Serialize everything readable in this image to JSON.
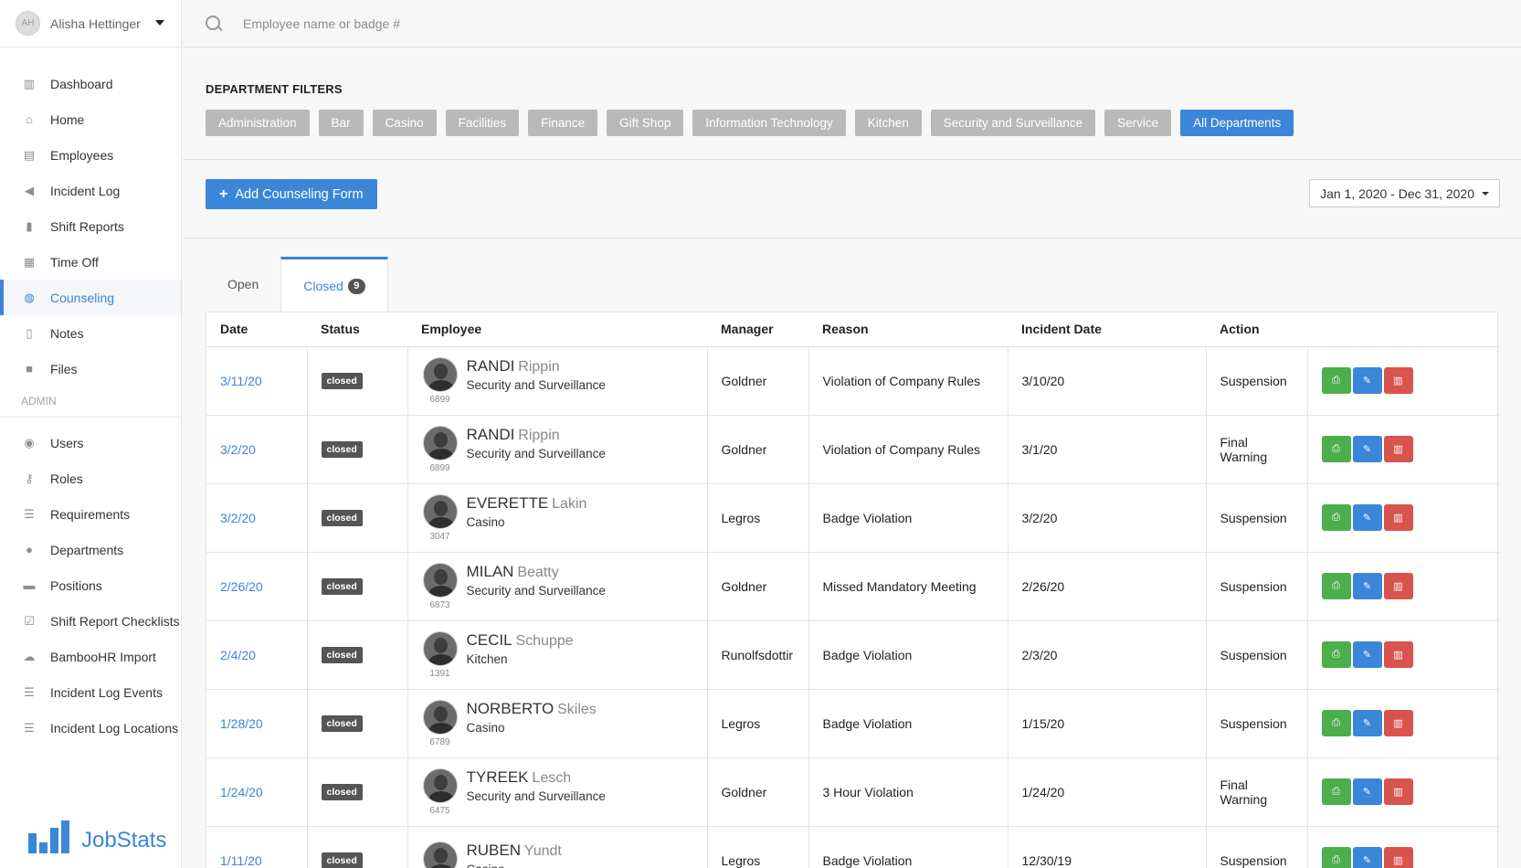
{
  "user": {
    "initials": "AH",
    "name": "Alisha Hettinger"
  },
  "nav": [
    {
      "label": "Dashboard",
      "icon": "bar-chart-icon",
      "glyph": "▥"
    },
    {
      "label": "Home",
      "icon": "home-icon",
      "glyph": "⌂"
    },
    {
      "label": "Employees",
      "icon": "id-card-icon",
      "glyph": "▤"
    },
    {
      "label": "Incident Log",
      "icon": "megaphone-icon",
      "glyph": "◀"
    },
    {
      "label": "Shift Reports",
      "icon": "file-icon",
      "glyph": "▮"
    },
    {
      "label": "Time Off",
      "icon": "calendar-icon",
      "glyph": "▦"
    },
    {
      "label": "Counseling",
      "icon": "comments-icon",
      "glyph": "◍"
    },
    {
      "label": "Notes",
      "icon": "file-text-icon",
      "glyph": "▯"
    },
    {
      "label": "Files",
      "icon": "folder-icon",
      "glyph": "■"
    }
  ],
  "admin_label": "ADMIN",
  "admin_nav": [
    {
      "label": "Users",
      "icon": "user-circle-icon",
      "glyph": "◉"
    },
    {
      "label": "Roles",
      "icon": "key-icon",
      "glyph": "⚷"
    },
    {
      "label": "Requirements",
      "icon": "list-icon",
      "glyph": "☰"
    },
    {
      "label": "Departments",
      "icon": "users-icon",
      "glyph": "●"
    },
    {
      "label": "Positions",
      "icon": "briefcase-icon",
      "glyph": "▬"
    },
    {
      "label": "Shift Report Checklists",
      "icon": "check-square-icon",
      "glyph": "☑"
    },
    {
      "label": "BambooHR Import",
      "icon": "cloud-download-icon",
      "glyph": "☁"
    },
    {
      "label": "Incident Log Events",
      "icon": "list-icon",
      "glyph": "☰"
    },
    {
      "label": "Incident Log Locations",
      "icon": "list-icon",
      "glyph": "☰"
    }
  ],
  "brand": "JobStats",
  "search": {
    "placeholder": "Employee name or badge #"
  },
  "filters": {
    "title": "DEPARTMENT FILTERS",
    "items": [
      "Administration",
      "Bar",
      "Casino",
      "Facilities",
      "Finance",
      "Gift Shop",
      "Information Technology",
      "Kitchen",
      "Security and Surveillance",
      "Service",
      "All Departments"
    ],
    "active": "All Departments"
  },
  "toolbar": {
    "add_label": "Add Counseling Form",
    "date_range": "Jan 1, 2020 - Dec 31, 2020"
  },
  "tabs": {
    "open": "Open",
    "closed": "Closed",
    "closed_count": "9"
  },
  "columns": [
    "Date",
    "Status",
    "Employee",
    "Manager",
    "Reason",
    "Incident Date",
    "Action"
  ],
  "rows": [
    {
      "date": "3/11/20",
      "status": "closed",
      "first": "RANDI",
      "last": "Rippin",
      "dept": "Security and Surveillance",
      "badge": "6899",
      "manager": "Goldner",
      "reason": "Violation of Company Rules",
      "incident_date": "3/10/20",
      "action": "Suspension"
    },
    {
      "date": "3/2/20",
      "status": "closed",
      "first": "RANDI",
      "last": "Rippin",
      "dept": "Security and Surveillance",
      "badge": "6899",
      "manager": "Goldner",
      "reason": "Violation of Company Rules",
      "incident_date": "3/1/20",
      "action": "Final Warning"
    },
    {
      "date": "3/2/20",
      "status": "closed",
      "first": "EVERETTE",
      "last": "Lakin",
      "dept": "Casino",
      "badge": "3047",
      "manager": "Legros",
      "reason": "Badge Violation",
      "incident_date": "3/2/20",
      "action": "Suspension"
    },
    {
      "date": "2/26/20",
      "status": "closed",
      "first": "MILAN",
      "last": "Beatty",
      "dept": "Security and Surveillance",
      "badge": "6873",
      "manager": "Goldner",
      "reason": "Missed Mandatory Meeting",
      "incident_date": "2/26/20",
      "action": "Suspension"
    },
    {
      "date": "2/4/20",
      "status": "closed",
      "first": "CECIL",
      "last": "Schuppe",
      "dept": "Kitchen",
      "badge": "1391",
      "manager": "Runolfsdottir",
      "reason": "Badge Violation",
      "incident_date": "2/3/20",
      "action": "Suspension"
    },
    {
      "date": "1/28/20",
      "status": "closed",
      "first": "NORBERTO",
      "last": "Skiles",
      "dept": "Casino",
      "badge": "6789",
      "manager": "Legros",
      "reason": "Badge Violation",
      "incident_date": "1/15/20",
      "action": "Suspension"
    },
    {
      "date": "1/24/20",
      "status": "closed",
      "first": "TYREEK",
      "last": "Lesch",
      "dept": "Security and Surveillance",
      "badge": "6475",
      "manager": "Goldner",
      "reason": "3 Hour Violation",
      "incident_date": "1/24/20",
      "action": "Final Warning"
    },
    {
      "date": "1/11/20",
      "status": "closed",
      "first": "RUBEN",
      "last": "Yundt",
      "dept": "Casino",
      "badge": "",
      "manager": "Legros",
      "reason": "Badge Violation",
      "incident_date": "12/30/19",
      "action": "Suspension"
    }
  ],
  "row_actions": {
    "print": "print-icon",
    "edit": "pencil-icon",
    "delete": "trash-icon"
  }
}
